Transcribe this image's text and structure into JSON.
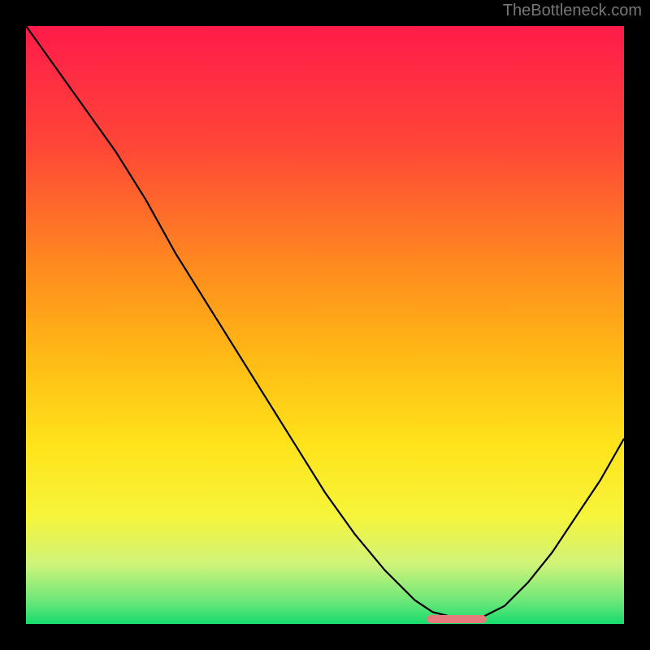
{
  "watermark": "TheBottleneck.com",
  "chart_data": {
    "type": "line",
    "title": "",
    "xlabel": "",
    "ylabel": "",
    "xlim": [
      0,
      1
    ],
    "ylim": [
      0,
      1
    ],
    "x": [
      0.0,
      0.05,
      0.1,
      0.15,
      0.2,
      0.25,
      0.3,
      0.35,
      0.4,
      0.45,
      0.5,
      0.55,
      0.6,
      0.65,
      0.68,
      0.72,
      0.76,
      0.8,
      0.84,
      0.88,
      0.92,
      0.96,
      1.0
    ],
    "values": [
      1.0,
      0.93,
      0.86,
      0.79,
      0.71,
      0.62,
      0.54,
      0.46,
      0.38,
      0.3,
      0.22,
      0.15,
      0.09,
      0.04,
      0.02,
      0.01,
      0.01,
      0.03,
      0.07,
      0.12,
      0.18,
      0.24,
      0.31
    ],
    "flat_zone": {
      "x0": 0.67,
      "x1": 0.77
    },
    "gradient_stops": [
      {
        "t": 0.0,
        "c": "#ff1b4a"
      },
      {
        "t": 0.2,
        "c": "#ff4637"
      },
      {
        "t": 0.4,
        "c": "#ff8a1f"
      },
      {
        "t": 0.55,
        "c": "#ffb915"
      },
      {
        "t": 0.7,
        "c": "#ffe31a"
      },
      {
        "t": 0.82,
        "c": "#f6f53b"
      },
      {
        "t": 0.9,
        "c": "#cff379"
      },
      {
        "t": 0.96,
        "c": "#6fe879"
      },
      {
        "t": 1.0,
        "c": "#18db6e"
      }
    ],
    "marker_color": "#e77a7a"
  }
}
